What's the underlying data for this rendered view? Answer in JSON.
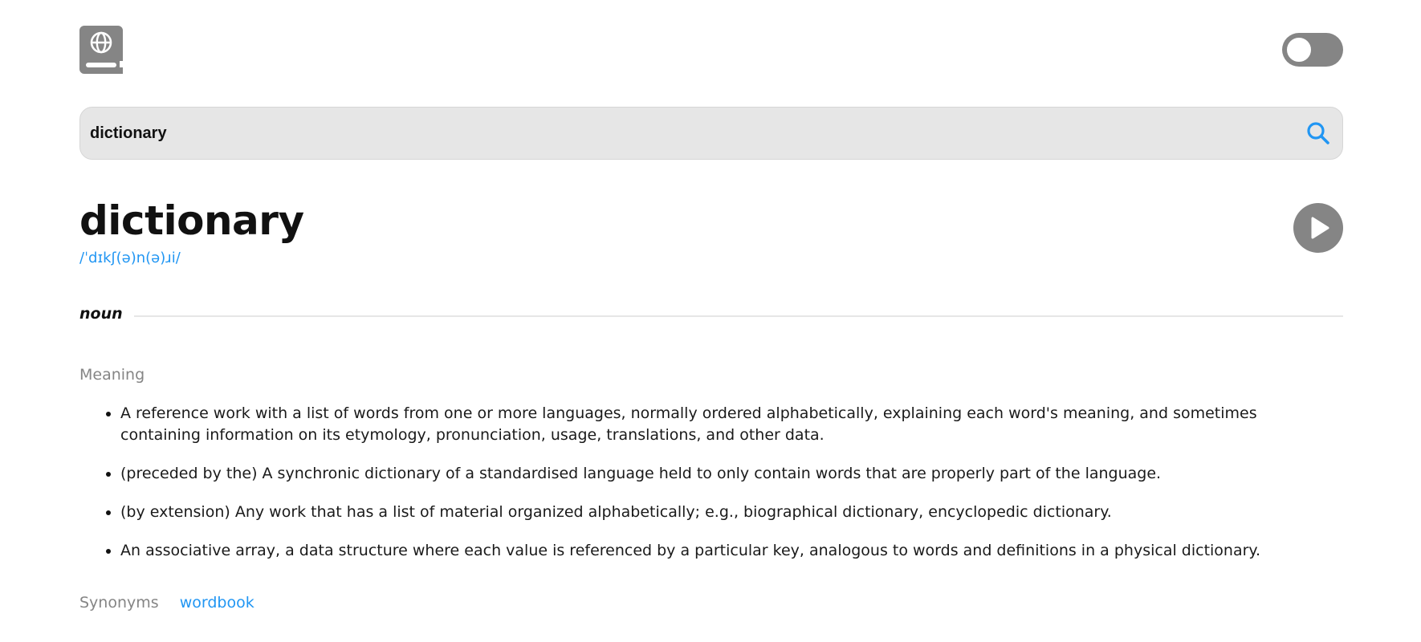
{
  "header": {
    "logo_icon": "book-globe-icon",
    "theme_toggle_icon": "toggle-switch-icon",
    "theme_toggle_state": "off"
  },
  "search": {
    "value": "dictionary",
    "button_icon": "search-icon",
    "accent_color": "#2196f3"
  },
  "entry": {
    "word": "dictionary",
    "phonetic": "/ˈdɪkʃ(ə)n(ə)ɹi/",
    "audio_button_icon": "play-icon"
  },
  "definitions": {
    "part_of_speech": "noun",
    "meaning_label": "Meaning",
    "meanings": [
      "A reference work with a list of words from one or more languages, normally ordered alphabetically, explaining each word's meaning, and sometimes containing information on its etymology, pronunciation, usage, translations, and other data.",
      "(preceded by the) A synchronic dictionary of a standardised language held to only contain words that are properly part of the language.",
      "(by extension) Any work that has a list of material organized alphabetically; e.g., biographical dictionary, encyclopedic dictionary.",
      "An associative array, a data structure where each value is referenced by a particular key, analogous to words and definitions in a physical dictionary."
    ],
    "synonyms_label": "Synonyms",
    "synonyms": [
      "wordbook"
    ]
  },
  "colors": {
    "accent": "#2196f3",
    "muted": "#858585",
    "search_bg": "#e6e6e6"
  }
}
